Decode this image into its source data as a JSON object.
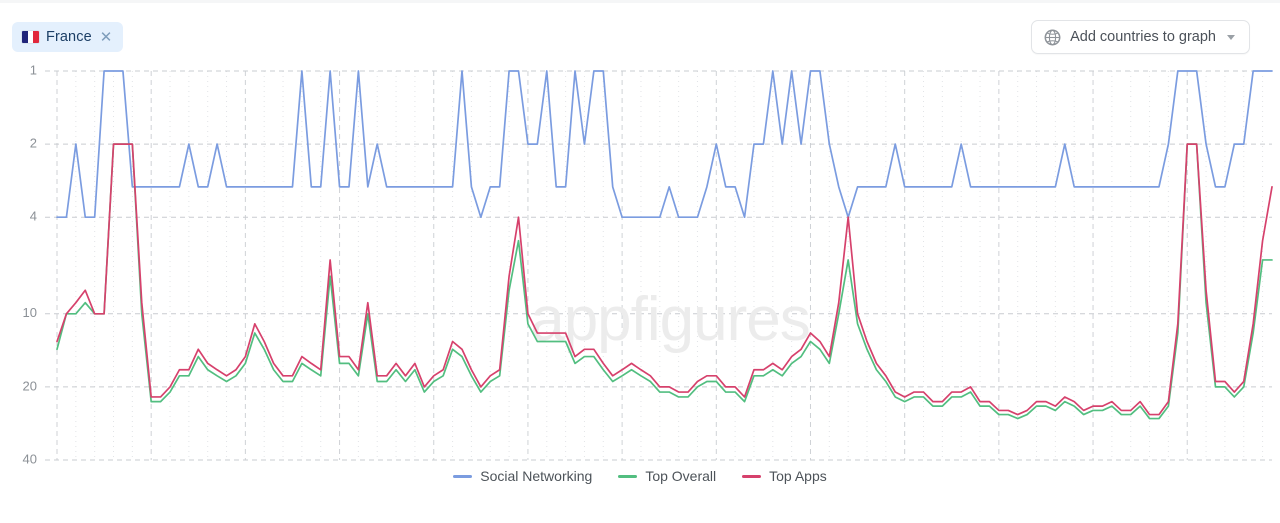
{
  "toolbar": {
    "country_chip": {
      "name": "France",
      "flag_icon": "flag-france-icon",
      "close_icon": "close-icon",
      "background_color": "#e4f0fd",
      "text_color": "#1c3f66"
    },
    "add_countries": {
      "label": "Add countries to graph",
      "globe_icon": "globe-icon",
      "caret_icon": "chevron-down-icon"
    }
  },
  "watermark": "appfigures",
  "legend": {
    "position": "bottom-center",
    "items": [
      {
        "label": "Social Networking",
        "color": "#7b9ce0"
      },
      {
        "label": "Top Overall",
        "color": "#52be80"
      },
      {
        "label": "Top Apps",
        "color": "#d6416c"
      }
    ]
  },
  "chart_data": {
    "type": "line",
    "title": "",
    "xlabel": "",
    "ylabel": "",
    "y_scale": "log-inverted-rank",
    "ylim": [
      1,
      40
    ],
    "yticks": [
      1,
      2,
      4,
      10,
      20,
      40
    ],
    "ytick_labels": [
      "1",
      "2",
      "4",
      "10",
      "20",
      "40"
    ],
    "grid": {
      "horizontal": "dashed",
      "vertical_major": "dashed",
      "vertical_minor": "dotted",
      "major_every": 10
    },
    "x_count": 130,
    "series": [
      {
        "name": "Social Networking",
        "color": "#7b9ce0",
        "values": [
          4,
          4,
          2,
          4,
          4,
          1,
          1,
          1,
          3,
          3,
          3,
          3,
          3,
          3,
          2,
          3,
          3,
          2,
          3,
          3,
          3,
          3,
          3,
          3,
          3,
          3,
          1,
          3,
          3,
          1,
          3,
          3,
          1,
          3,
          2,
          3,
          3,
          3,
          3,
          3,
          3,
          3,
          3,
          1,
          3,
          4,
          3,
          3,
          1,
          1,
          2,
          2,
          1,
          3,
          3,
          1,
          2,
          1,
          1,
          3,
          4,
          4,
          4,
          4,
          4,
          3,
          4,
          4,
          4,
          3,
          2,
          3,
          3,
          4,
          2,
          2,
          1,
          2,
          1,
          2,
          1,
          1,
          2,
          3,
          4,
          3,
          3,
          3,
          3,
          2,
          3,
          3,
          3,
          3,
          3,
          3,
          2,
          3,
          3,
          3,
          3,
          3,
          3,
          3,
          3,
          3,
          3,
          2,
          3,
          3,
          3,
          3,
          3,
          3,
          3,
          3,
          3,
          3,
          2,
          1,
          1,
          1,
          2,
          3,
          3,
          2,
          2,
          1,
          1,
          1
        ]
      },
      {
        "name": "Top Overall",
        "color": "#52be80",
        "values": [
          14,
          10,
          10,
          9,
          10,
          10,
          2,
          2,
          2,
          10,
          23,
          23,
          21,
          18,
          18,
          15,
          17,
          18,
          19,
          18,
          16,
          12,
          14,
          17,
          19,
          19,
          16,
          17,
          18,
          7,
          16,
          16,
          18,
          10,
          19,
          19,
          17,
          19,
          17,
          21,
          19,
          18,
          14,
          15,
          18,
          21,
          19,
          18,
          8,
          5,
          11,
          13,
          13,
          13,
          13,
          16,
          15,
          15,
          17,
          19,
          18,
          17,
          18,
          19,
          21,
          21,
          22,
          22,
          20,
          19,
          19,
          21,
          21,
          23,
          18,
          18,
          17,
          18,
          16,
          15,
          13,
          14,
          16,
          10,
          6,
          11,
          14,
          17,
          19,
          22,
          23,
          22,
          22,
          24,
          24,
          22,
          22,
          21,
          24,
          24,
          26,
          26,
          27,
          26,
          24,
          24,
          25,
          23,
          24,
          26,
          25,
          25,
          24,
          26,
          26,
          24,
          27,
          27,
          24,
          12,
          2,
          2,
          9,
          20,
          20,
          22,
          20,
          12,
          6,
          6
        ]
      },
      {
        "name": "Top Apps",
        "color": "#d6416c",
        "values": [
          13,
          10,
          9,
          8,
          10,
          10,
          2,
          2,
          2,
          9,
          22,
          22,
          20,
          17,
          17,
          14,
          16,
          17,
          18,
          17,
          15,
          11,
          13,
          16,
          18,
          18,
          15,
          16,
          17,
          6,
          15,
          15,
          17,
          9,
          18,
          18,
          16,
          18,
          16,
          20,
          18,
          17,
          13,
          14,
          17,
          20,
          18,
          17,
          7,
          4,
          10,
          12,
          12,
          12,
          12,
          15,
          14,
          14,
          16,
          18,
          17,
          16,
          17,
          18,
          20,
          20,
          21,
          21,
          19,
          18,
          18,
          20,
          20,
          22,
          17,
          17,
          16,
          17,
          15,
          14,
          12,
          13,
          15,
          9,
          4,
          10,
          13,
          16,
          18,
          21,
          22,
          21,
          21,
          23,
          23,
          21,
          21,
          20,
          23,
          23,
          25,
          25,
          26,
          25,
          23,
          23,
          24,
          22,
          23,
          25,
          24,
          24,
          23,
          25,
          25,
          23,
          26,
          26,
          23,
          11,
          2,
          2,
          8,
          19,
          19,
          21,
          19,
          11,
          5,
          3
        ]
      }
    ]
  }
}
